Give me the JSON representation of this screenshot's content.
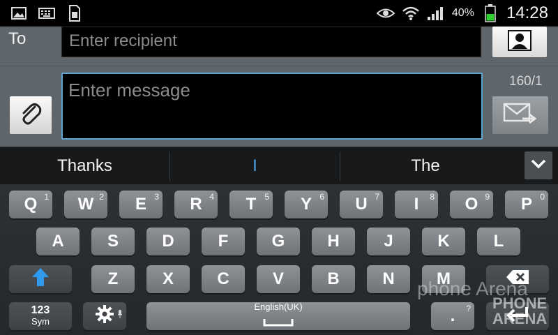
{
  "status_bar": {
    "left_icons": [
      "image-icon",
      "keyboard-icon",
      "sim-icon"
    ],
    "right_icons": [
      "eye-icon",
      "wifi-icon",
      "signal-icon",
      "battery-icon"
    ],
    "battery_percent": "40%",
    "time": "14:28",
    "battery_color": "#2fd22f"
  },
  "compose": {
    "to_label": "To",
    "recipient_placeholder": "Enter recipient",
    "message_placeholder": "Enter message",
    "char_counter": "160/1",
    "focus_color": "#5aa4d6"
  },
  "suggestions": {
    "items": [
      "Thanks",
      "I",
      "The"
    ]
  },
  "keyboard": {
    "row1": [
      {
        "label": "Q",
        "num": "1"
      },
      {
        "label": "W",
        "num": "2"
      },
      {
        "label": "E",
        "num": "3"
      },
      {
        "label": "R",
        "num": "4"
      },
      {
        "label": "T",
        "num": "5"
      },
      {
        "label": "Y",
        "num": "6"
      },
      {
        "label": "U",
        "num": "7"
      },
      {
        "label": "I",
        "num": "8"
      },
      {
        "label": "O",
        "num": "9"
      },
      {
        "label": "P",
        "num": "0"
      }
    ],
    "row2": [
      "A",
      "S",
      "D",
      "F",
      "G",
      "H",
      "J",
      "K",
      "L"
    ],
    "row3": [
      "Z",
      "X",
      "C",
      "V",
      "B",
      "N",
      "M"
    ],
    "sym_label_top": "123",
    "sym_label_bottom": "Sym",
    "space_label": "English(UK)",
    "period_label": ".",
    "period_hint": "?",
    "shift_color": "#2e9bf0"
  },
  "watermark": {
    "line1": "phone Arena",
    "line2": "PHONE",
    "line3": "ARENA"
  }
}
